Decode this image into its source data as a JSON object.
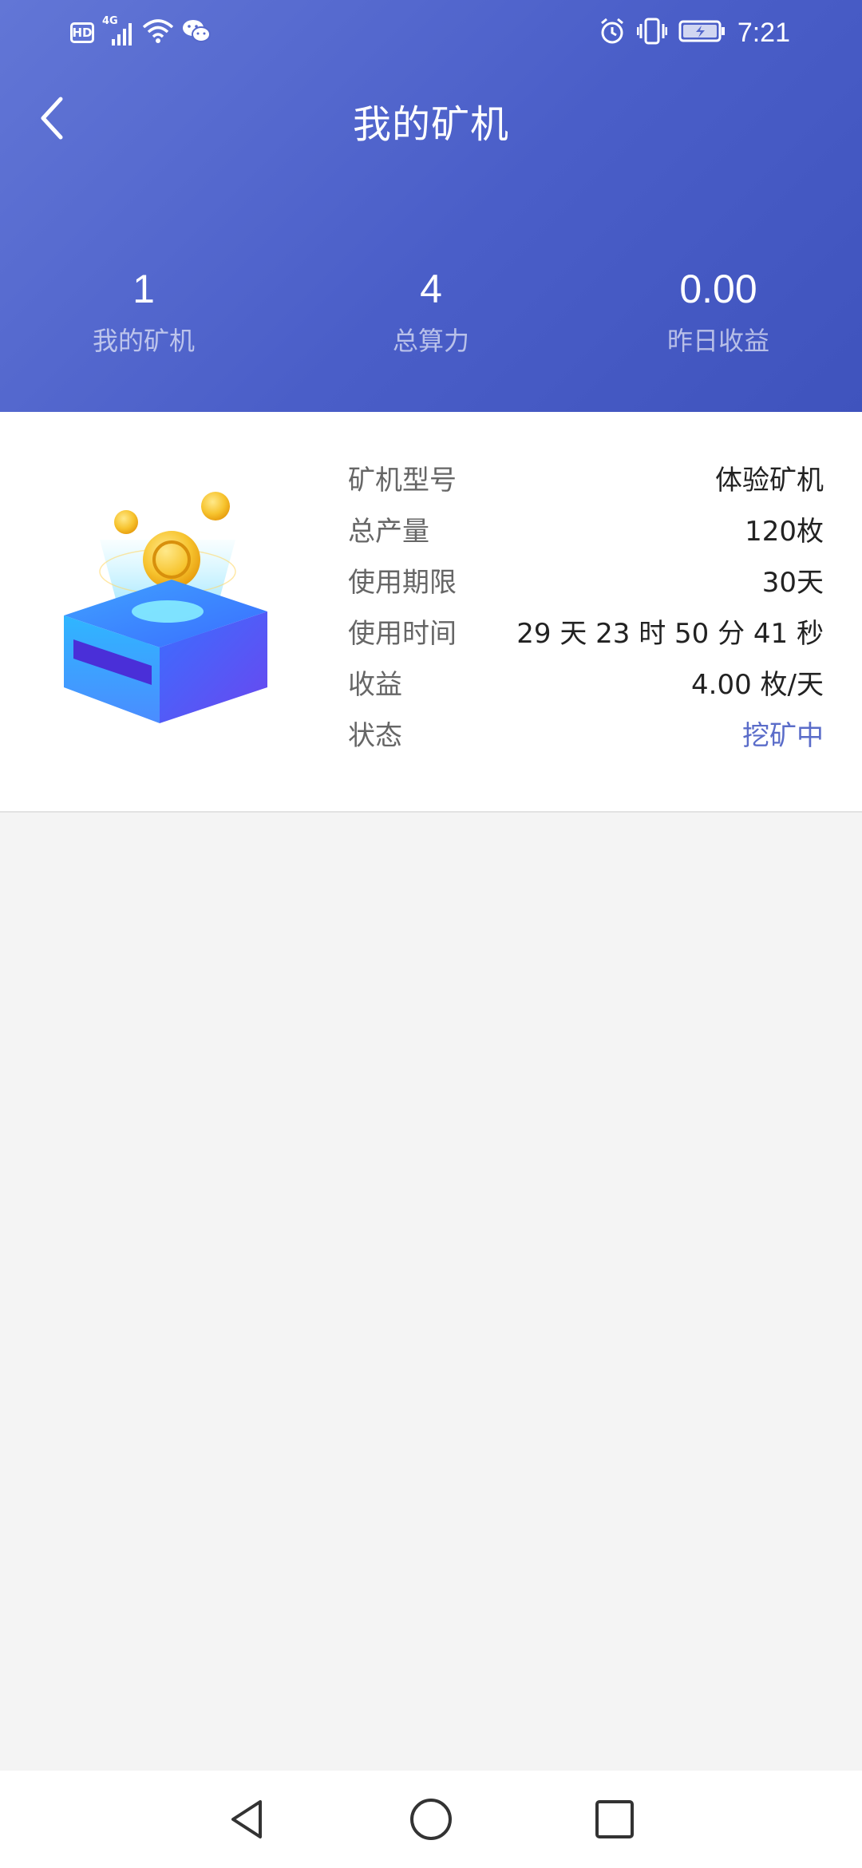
{
  "status_bar": {
    "left_icons": [
      "hd-icon",
      "signal-4g-icon",
      "wifi-icon",
      "wechat-icon"
    ],
    "hd_label": "HD",
    "network_label": "4G",
    "right_icons": [
      "alarm-icon",
      "vibrate-icon",
      "battery-charging-icon"
    ],
    "time": "7:21"
  },
  "header": {
    "title": "我的矿机",
    "back_icon": "chevron-left-icon",
    "stats": [
      {
        "value": "1",
        "label": "我的矿机"
      },
      {
        "value": "4",
        "label": "总算力"
      },
      {
        "value": "0.00",
        "label": "昨日收益"
      }
    ]
  },
  "miner": {
    "image_icon": "mining-box-illustration",
    "rows": [
      {
        "label": "矿机型号",
        "value": "体验矿机"
      },
      {
        "label": "总产量",
        "value": "120枚"
      },
      {
        "label": "使用期限",
        "value": "30天"
      },
      {
        "label": "使用时间",
        "value": "29 天 23 时 50 分 41 秒"
      },
      {
        "label": "收益",
        "value": "4.00 枚/天"
      },
      {
        "label": "状态",
        "value": "挖矿中"
      }
    ]
  },
  "nav_bar": {
    "icons": [
      "back-triangle-icon",
      "home-circle-icon",
      "recents-square-icon"
    ]
  },
  "colors": {
    "header_gradient_start": "#6276d6",
    "header_gradient_end": "#3f53bd",
    "status_active": "#5a6cc9",
    "background": "#f4f4f4"
  }
}
